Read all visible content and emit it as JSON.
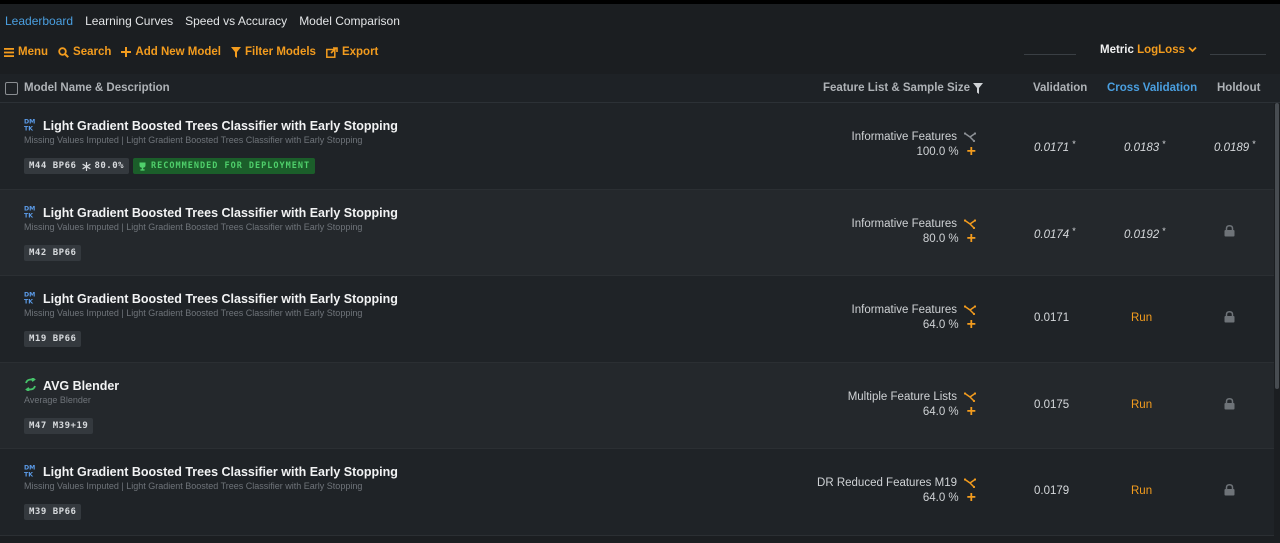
{
  "tabs": [
    {
      "label": "Leaderboard"
    },
    {
      "label": "Learning Curves"
    },
    {
      "label": "Speed vs Accuracy"
    },
    {
      "label": "Model Comparison"
    }
  ],
  "toolbar": {
    "menu": "Menu",
    "search": "Search",
    "add": "Add New Model",
    "filter": "Filter Models",
    "export": "Export"
  },
  "metric": {
    "label": "Metric",
    "value": "LogLoss"
  },
  "headers": {
    "name": "Model Name & Description",
    "feature": "Feature List & Sample Size",
    "validation": "Validation",
    "cross_validation": "Cross Validation",
    "holdout": "Holdout"
  },
  "recommended_label": "RECOMMENDED FOR DEPLOYMENT",
  "rows": [
    {
      "name": "Light Gradient Boosted Trees Classifier with Early Stopping",
      "desc": "Missing Values Imputed | Light Gradient Boosted Trees Classifier with Early Stopping",
      "badge": [
        "M44",
        "BP66"
      ],
      "sample_badge": "80.0%",
      "feature": "Informative Features",
      "size": "100.0 %",
      "validation": "0.0171",
      "cv": "0.0183",
      "holdout": "0.0189"
    },
    {
      "name": "Light Gradient Boosted Trees Classifier with Early Stopping",
      "desc": "Missing Values Imputed | Light Gradient Boosted Trees Classifier with Early Stopping",
      "badge": [
        "M42",
        "BP66"
      ],
      "feature": "Informative Features",
      "size": "80.0 %",
      "validation": "0.0174",
      "cv": "0.0192"
    },
    {
      "name": "Light Gradient Boosted Trees Classifier with Early Stopping",
      "desc": "Missing Values Imputed | Light Gradient Boosted Trees Classifier with Early Stopping",
      "badge": [
        "M19",
        "BP66"
      ],
      "feature": "Informative Features",
      "size": "64.0 %",
      "validation": "0.0171",
      "cv": "Run"
    },
    {
      "name": "AVG Blender",
      "desc": "Average Blender",
      "badge": [
        "M47",
        "M39+19"
      ],
      "feature": "Multiple Feature Lists",
      "size": "64.0 %",
      "validation": "0.0175",
      "cv": "Run"
    },
    {
      "name": "Light Gradient Boosted Trees Classifier with Early Stopping",
      "desc": "Missing Values Imputed | Light Gradient Boosted Trees Classifier with Early Stopping",
      "badge": [
        "M39",
        "BP66"
      ],
      "feature": "DR Reduced Features M19",
      "size": "64.0 %",
      "validation": "0.0179",
      "cv": "Run"
    }
  ],
  "star": "*",
  "colors": {
    "accent": "#f39c1e",
    "link": "#4a9fe0",
    "recommended": "#4fd06b"
  }
}
